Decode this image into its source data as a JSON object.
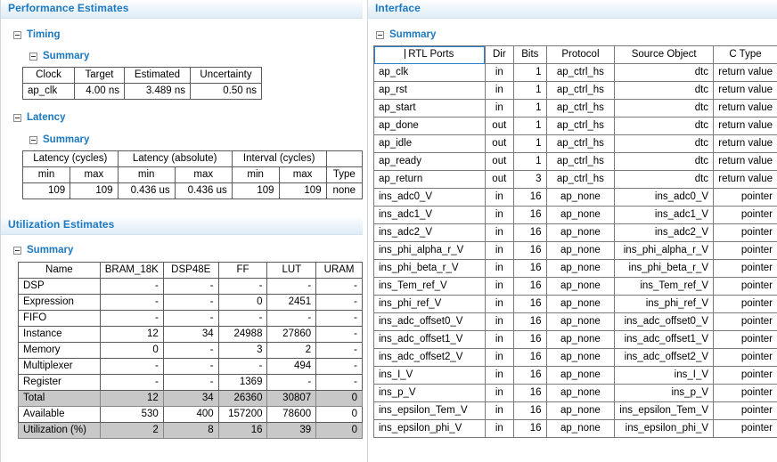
{
  "left_panel": {
    "sections": [
      {
        "id": "performance",
        "title": "Performance Estimates",
        "nodes": {
          "timing": "Timing",
          "timing_summary": "Summary",
          "latency": "Latency",
          "latency_summary": "Summary"
        },
        "timing_table": {
          "headers": [
            "Clock",
            "Target",
            "Estimated",
            "Uncertainty"
          ],
          "rows": [
            [
              "ap_clk",
              "4.00 ns",
              "3.489 ns",
              "0.50 ns"
            ]
          ]
        },
        "latency_table": {
          "group_headers": [
            "Latency (cycles)",
            "Latency (absolute)",
            "Interval (cycles)",
            ""
          ],
          "sub_headers": [
            "min",
            "max",
            "min",
            "max",
            "min",
            "max",
            "Type"
          ],
          "rows": [
            [
              "109",
              "109",
              "0.436 us",
              "0.436 us",
              "109",
              "109",
              "none"
            ]
          ]
        }
      },
      {
        "id": "utilization",
        "title": "Utilization Estimates",
        "nodes": {
          "summary": "Summary"
        },
        "util_table": {
          "headers": [
            "Name",
            "BRAM_18K",
            "DSP48E",
            "FF",
            "LUT",
            "URAM"
          ],
          "rows": [
            {
              "name": "DSP",
              "cells": [
                "-",
                "-",
                "-",
                "-",
                "-"
              ],
              "shaded": false
            },
            {
              "name": "Expression",
              "cells": [
                "-",
                "-",
                "0",
                "2451",
                "-"
              ],
              "shaded": false
            },
            {
              "name": "FIFO",
              "cells": [
                "-",
                "-",
                "-",
                "-",
                "-"
              ],
              "shaded": false
            },
            {
              "name": "Instance",
              "cells": [
                "12",
                "34",
                "24988",
                "27860",
                "-"
              ],
              "shaded": false
            },
            {
              "name": "Memory",
              "cells": [
                "0",
                "-",
                "3",
                "2",
                "-"
              ],
              "shaded": false
            },
            {
              "name": "Multiplexer",
              "cells": [
                "-",
                "-",
                "-",
                "494",
                "-"
              ],
              "shaded": false
            },
            {
              "name": "Register",
              "cells": [
                "-",
                "-",
                "1369",
                "-",
                "-"
              ],
              "shaded": false
            },
            {
              "name": "Total",
              "cells": [
                "12",
                "34",
                "26360",
                "30807",
                "0"
              ],
              "shaded": true
            },
            {
              "name": "Available",
              "cells": [
                "530",
                "400",
                "157200",
                "78600",
                "0"
              ],
              "shaded": false
            },
            {
              "name": "Utilization (%)",
              "cells": [
                "2",
                "8",
                "16",
                "39",
                "0"
              ],
              "shaded": true
            }
          ]
        }
      }
    ]
  },
  "right_panel": {
    "title": "Interface",
    "nodes": {
      "summary": "Summary"
    },
    "iface_table": {
      "headers": [
        "RTL Ports",
        "Dir",
        "Bits",
        "Protocol",
        "Source Object",
        "C Type"
      ],
      "rows": [
        [
          "ap_clk",
          "in",
          "1",
          "ap_ctrl_hs",
          "dtc",
          "return value"
        ],
        [
          "ap_rst",
          "in",
          "1",
          "ap_ctrl_hs",
          "dtc",
          "return value"
        ],
        [
          "ap_start",
          "in",
          "1",
          "ap_ctrl_hs",
          "dtc",
          "return value"
        ],
        [
          "ap_done",
          "out",
          "1",
          "ap_ctrl_hs",
          "dtc",
          "return value"
        ],
        [
          "ap_idle",
          "out",
          "1",
          "ap_ctrl_hs",
          "dtc",
          "return value"
        ],
        [
          "ap_ready",
          "out",
          "1",
          "ap_ctrl_hs",
          "dtc",
          "return value"
        ],
        [
          "ap_return",
          "out",
          "3",
          "ap_ctrl_hs",
          "dtc",
          "return value"
        ],
        [
          "ins_adc0_V",
          "in",
          "16",
          "ap_none",
          "ins_adc0_V",
          "pointer"
        ],
        [
          "ins_adc1_V",
          "in",
          "16",
          "ap_none",
          "ins_adc1_V",
          "pointer"
        ],
        [
          "ins_adc2_V",
          "in",
          "16",
          "ap_none",
          "ins_adc2_V",
          "pointer"
        ],
        [
          "ins_phi_alpha_r_V",
          "in",
          "16",
          "ap_none",
          "ins_phi_alpha_r_V",
          "pointer"
        ],
        [
          "ins_phi_beta_r_V",
          "in",
          "16",
          "ap_none",
          "ins_phi_beta_r_V",
          "pointer"
        ],
        [
          "ins_Tem_ref_V",
          "in",
          "16",
          "ap_none",
          "ins_Tem_ref_V",
          "pointer"
        ],
        [
          "ins_phi_ref_V",
          "in",
          "16",
          "ap_none",
          "ins_phi_ref_V",
          "pointer"
        ],
        [
          "ins_adc_offset0_V",
          "in",
          "16",
          "ap_none",
          "ins_adc_offset0_V",
          "pointer"
        ],
        [
          "ins_adc_offset1_V",
          "in",
          "16",
          "ap_none",
          "ins_adc_offset1_V",
          "pointer"
        ],
        [
          "ins_adc_offset2_V",
          "in",
          "16",
          "ap_none",
          "ins_adc_offset2_V",
          "pointer"
        ],
        [
          "ins_I_V",
          "in",
          "16",
          "ap_none",
          "ins_I_V",
          "pointer"
        ],
        [
          "ins_p_V",
          "in",
          "16",
          "ap_none",
          "ins_p_V",
          "pointer"
        ],
        [
          "ins_epsilon_Tem_V",
          "in",
          "16",
          "ap_none",
          "ins_epsilon_Tem_V",
          "pointer"
        ],
        [
          "ins_epsilon_phi_V",
          "in",
          "16",
          "ap_none",
          "ins_epsilon_phi_V",
          "pointer"
        ]
      ]
    }
  },
  "colors": {
    "header_text": "#1c79c0",
    "panel_gradient_top": "#ffffff",
    "panel_gradient_bottom": "#dfedf8",
    "table_border": "#5a5a5a",
    "shade_row": "#c8c8c8",
    "focus_outline": "#2a7fcd"
  }
}
